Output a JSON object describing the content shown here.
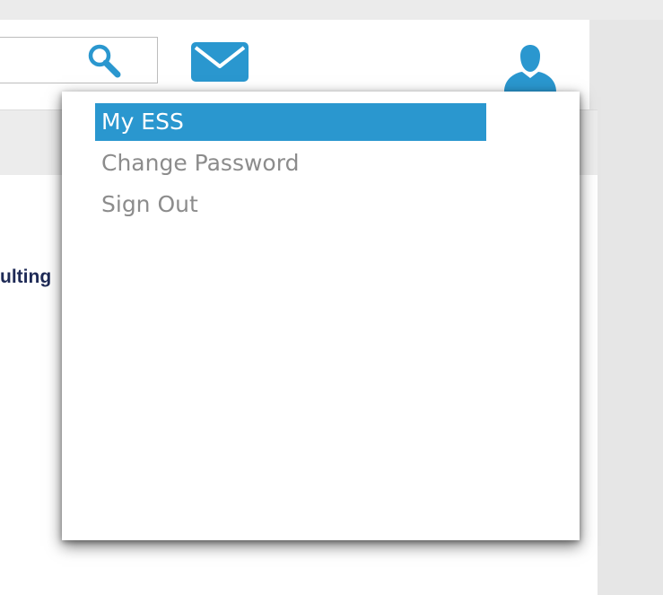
{
  "header": {
    "search": {
      "value": "",
      "placeholder": ""
    },
    "icons": {
      "search": "search-icon",
      "mail": "mail-icon",
      "user": "user-icon"
    }
  },
  "content": {
    "partial_text": "ulting"
  },
  "user_menu": {
    "items": [
      {
        "label": "My ESS",
        "selected": true
      },
      {
        "label": "Change Password",
        "selected": false
      },
      {
        "label": "Sign Out",
        "selected": false
      }
    ]
  },
  "colors": {
    "accent": "#2a97cf",
    "menu_text": "#8c8c8c",
    "content_text": "#1e2a56",
    "background": "#e6e6e6"
  }
}
